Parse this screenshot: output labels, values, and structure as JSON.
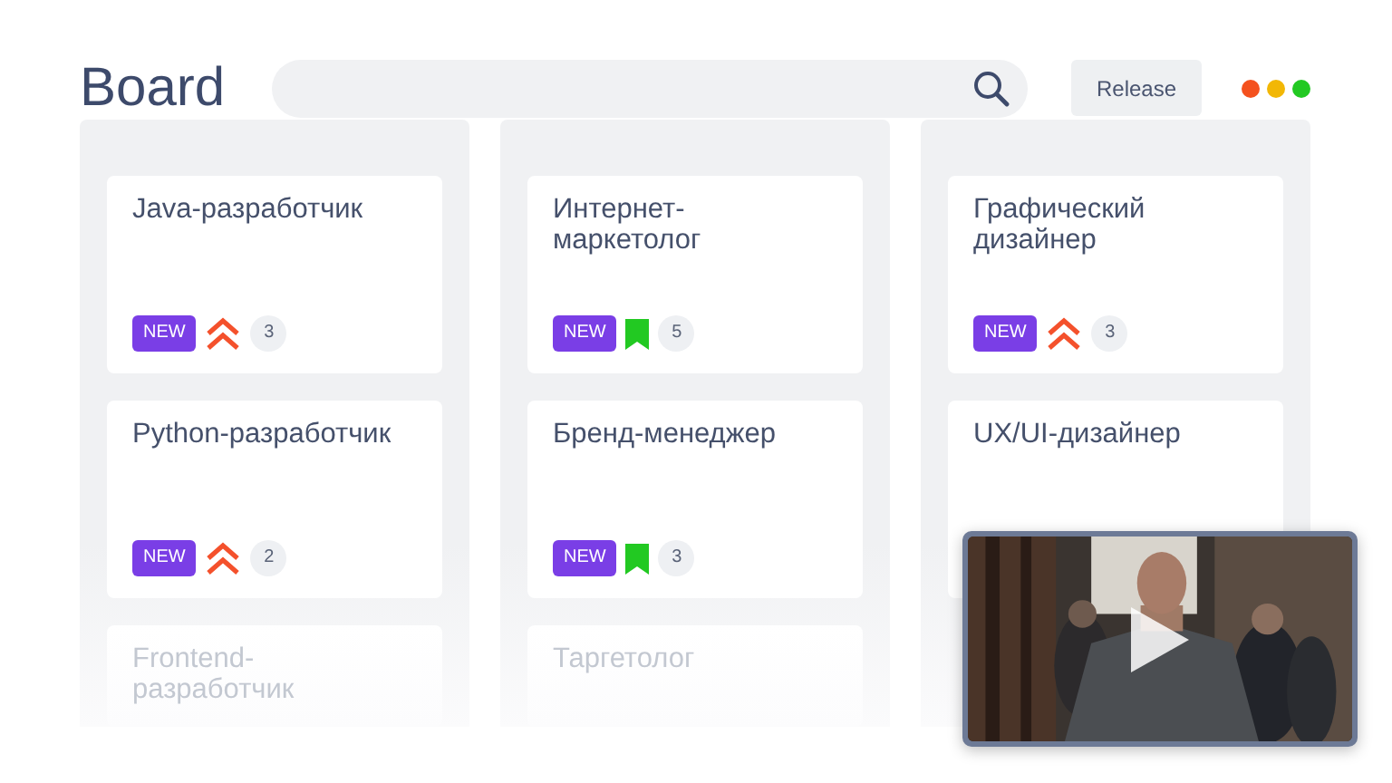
{
  "header": {
    "title": "Board",
    "release_button": "Release",
    "window_dots": [
      {
        "color": "#f4511e"
      },
      {
        "color": "#f2b705"
      },
      {
        "color": "#22c922"
      }
    ]
  },
  "columns": [
    {
      "cards": [
        {
          "title": "Java-разработчик",
          "faded": false,
          "badge": "NEW",
          "kind": "priority",
          "count": "3"
        },
        {
          "title": "Python-разработчик",
          "faded": false,
          "badge": "NEW",
          "kind": "priority",
          "count": "2"
        },
        {
          "title": "Frontend-разработчик",
          "faded": true
        }
      ]
    },
    {
      "cards": [
        {
          "title": "Интернет-маркетолог",
          "faded": false,
          "badge": "NEW",
          "kind": "bookmark",
          "count": "5"
        },
        {
          "title": "Бренд-менеджер",
          "faded": false,
          "badge": "NEW",
          "kind": "bookmark",
          "count": "3"
        },
        {
          "title": "Таргетолог",
          "faded": true
        }
      ]
    },
    {
      "cards": [
        {
          "title": "Графический дизайнер",
          "faded": false,
          "badge": "NEW",
          "kind": "priority",
          "count": "3"
        },
        {
          "title": "UX/UI-дизайнер",
          "faded": false
        }
      ]
    }
  ]
}
